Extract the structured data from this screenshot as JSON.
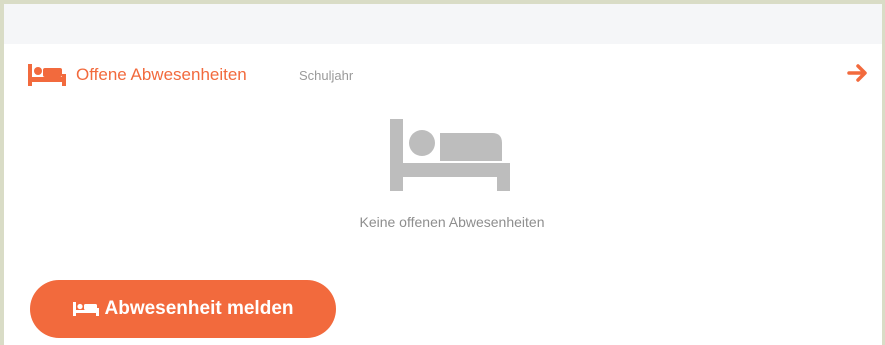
{
  "header": {
    "title": "Offene Abwesenheiten",
    "filter": "Schuljahr",
    "icon": "bed-icon",
    "arrow_icon": "arrow-right-icon"
  },
  "empty_state": {
    "icon": "bed-icon",
    "message": "Keine offenen Abwesenheiten"
  },
  "actions": {
    "report_label": "Abwesenheit melden",
    "report_icon": "bed-icon"
  },
  "colors": {
    "accent": "#f26a3d",
    "muted_icon": "#bdbdbd",
    "muted_text": "#8e8e8e",
    "frame": "#d9dcc6"
  }
}
